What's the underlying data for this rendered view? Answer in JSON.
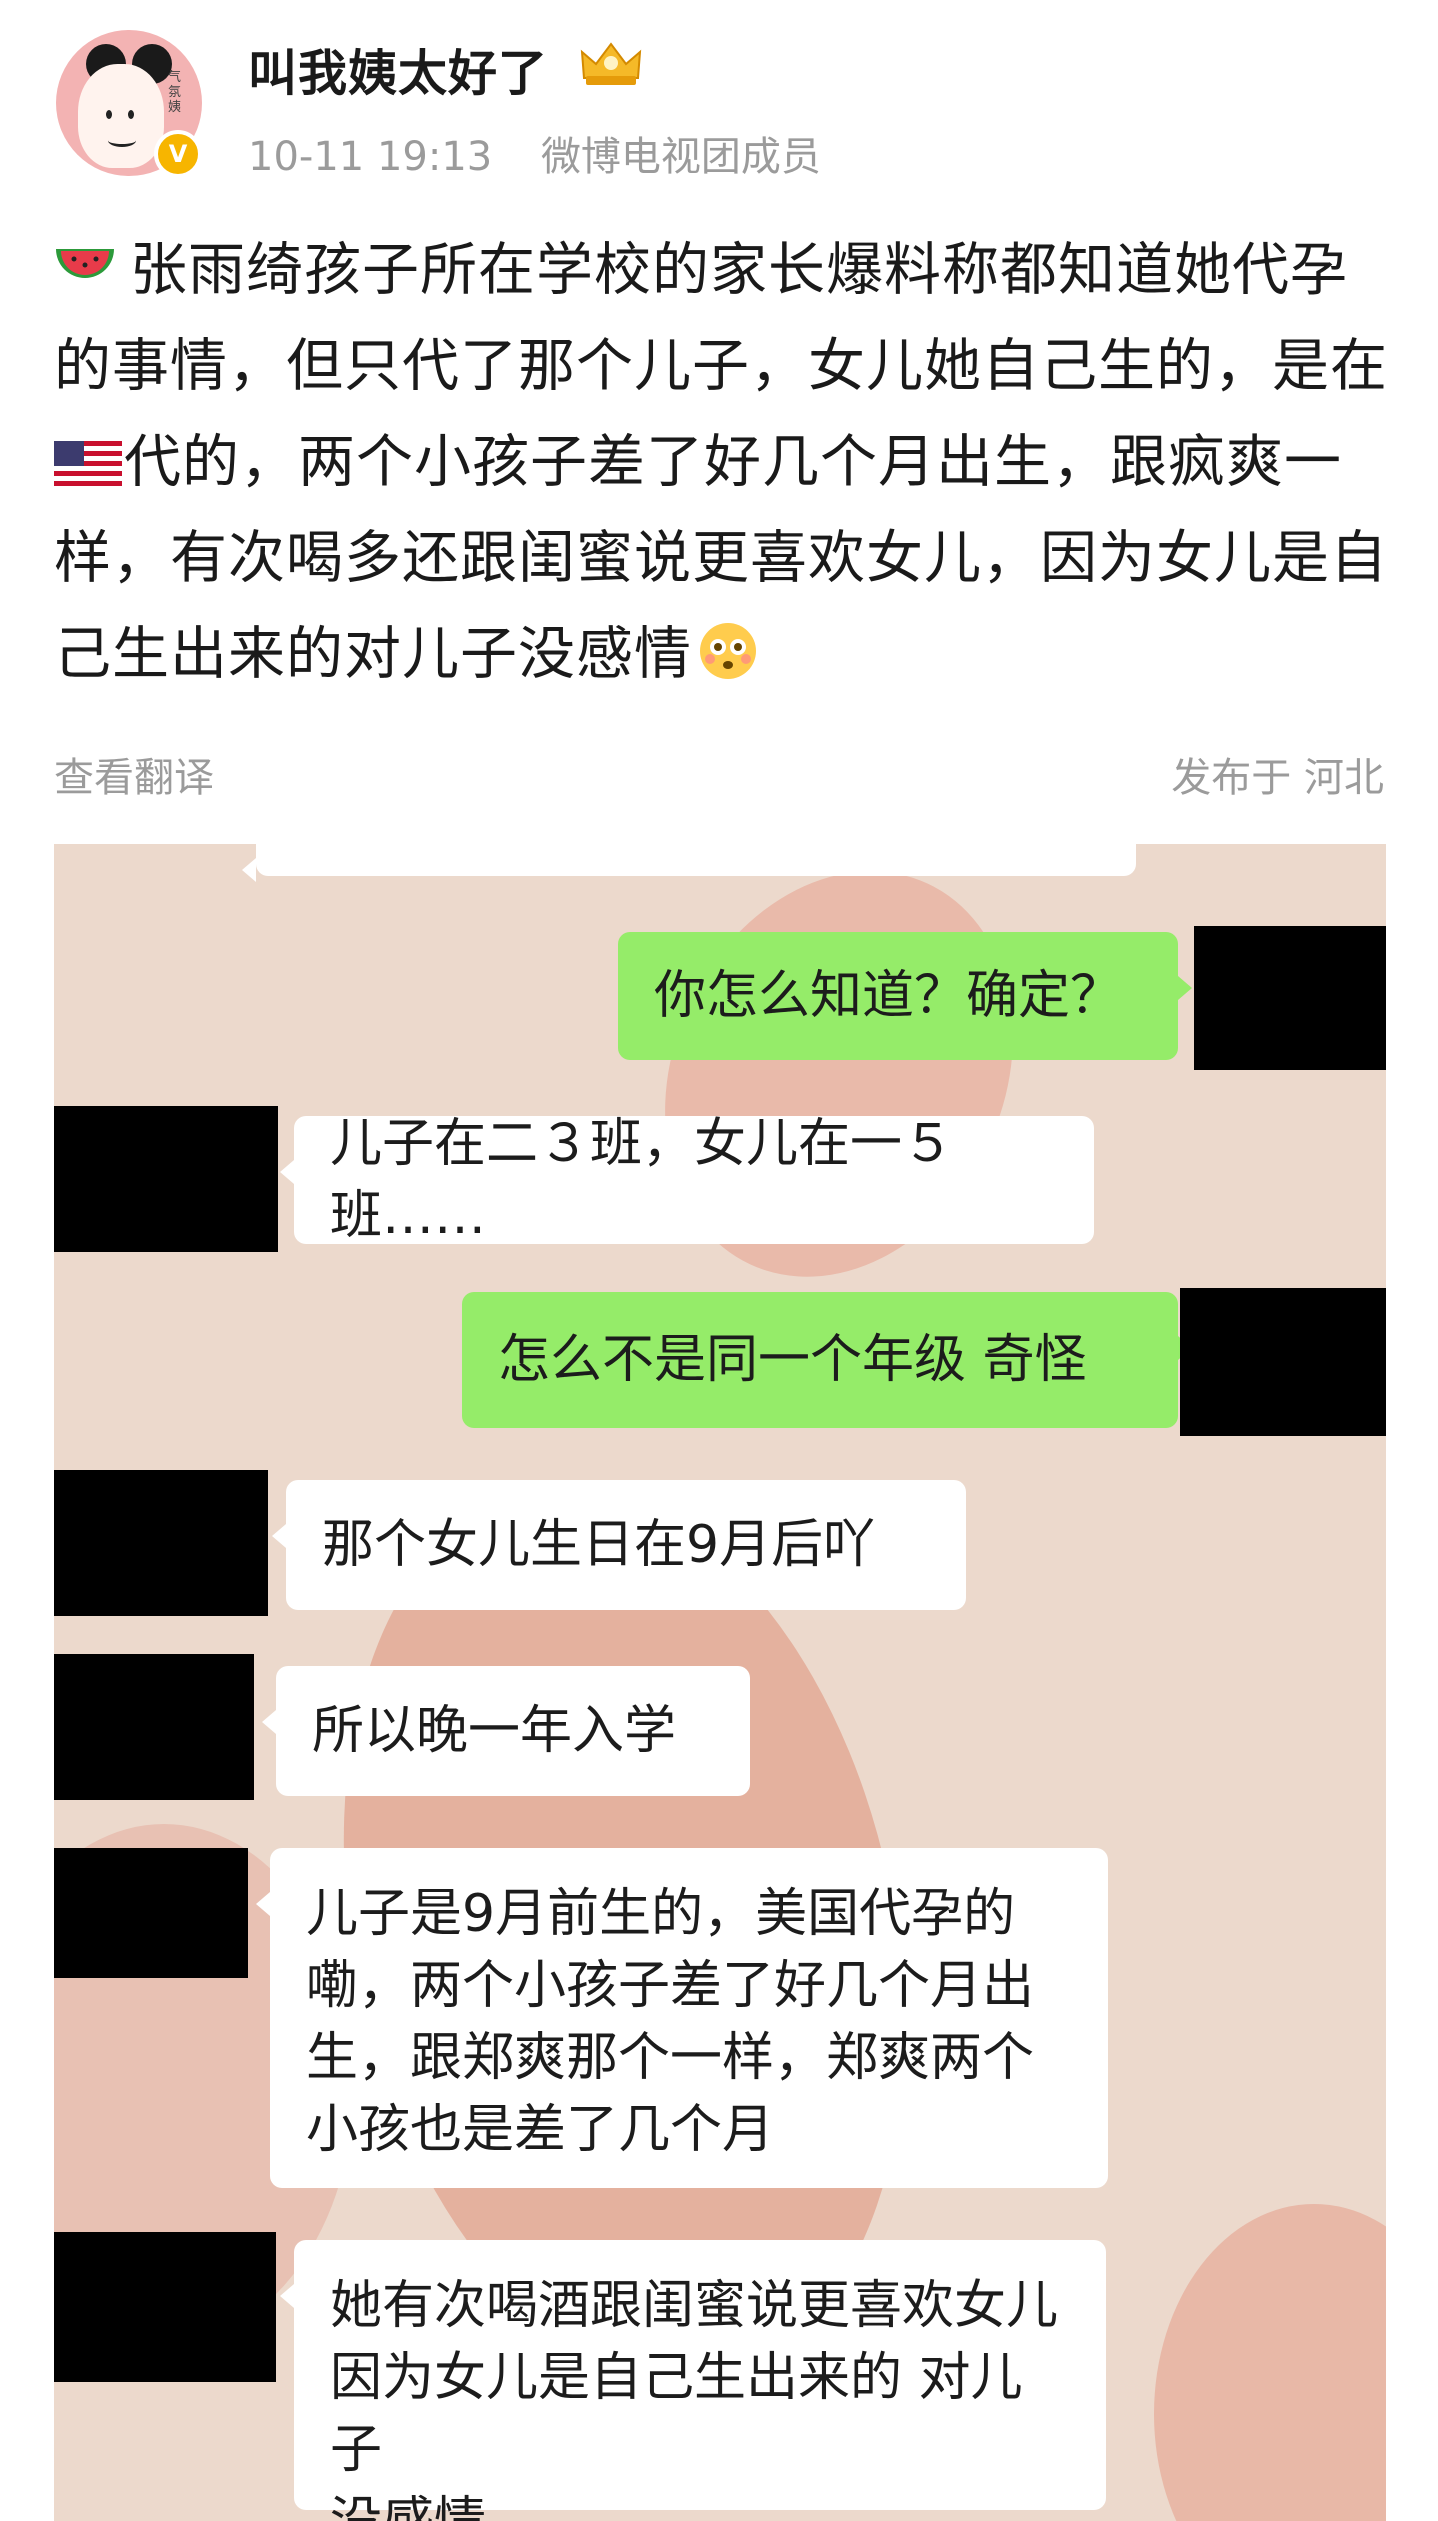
{
  "post": {
    "username": "叫我姨太好了",
    "timestamp": "10-11 19:13",
    "member_label": "微博电视团成员",
    "verified_badge": "V",
    "avatar_scribble": "气氛姨",
    "text_lines": [
      "张雨绮孩子所在学校的家长爆料称都知道她代孕",
      "的事情，但只代了那个儿子，女儿她自己生的，是在",
      "代的，两个小孩子差了好几个月出生，跟疯爽一",
      "样，有次喝多还跟闺蜜说更喜欢女儿，因为女儿是自",
      "己生出来的对儿子没感情"
    ],
    "translate_link": "查看翻译",
    "location": "发布于 河北",
    "icons": [
      "watermelon-emoji",
      "us-flag-emoji",
      "flushed-face-emoji",
      "crown-icon",
      "verified-icon"
    ]
  },
  "chat": {
    "messages": [
      {
        "side": "me",
        "text": "你怎么知道？确定？"
      },
      {
        "side": "them",
        "text": "儿子在二３班，女儿在一５班……"
      },
      {
        "side": "me",
        "text": "怎么不是同一个年级 奇怪"
      },
      {
        "side": "them",
        "text": "那个女儿生日在9月后吖"
      },
      {
        "side": "them",
        "text": "所以晚一年入学"
      },
      {
        "side": "them",
        "lines": [
          "儿子是9月前生的，美国代孕的",
          "嘞，两个小孩子差了好几个月出",
          "生，跟郑爽那个一样，郑爽两个",
          "小孩也是差了几个月"
        ]
      },
      {
        "side": "them",
        "lines": [
          "她有次喝酒跟闺蜜说更喜欢女儿",
          "因为女儿是自己生出来的 对儿子",
          "没感情"
        ]
      }
    ]
  },
  "colors": {
    "my_bubble": "#95ec69",
    "their_bubble": "#ffffff",
    "chat_background": "#ecd9cc",
    "meta_gray": "#9b9b9b"
  }
}
